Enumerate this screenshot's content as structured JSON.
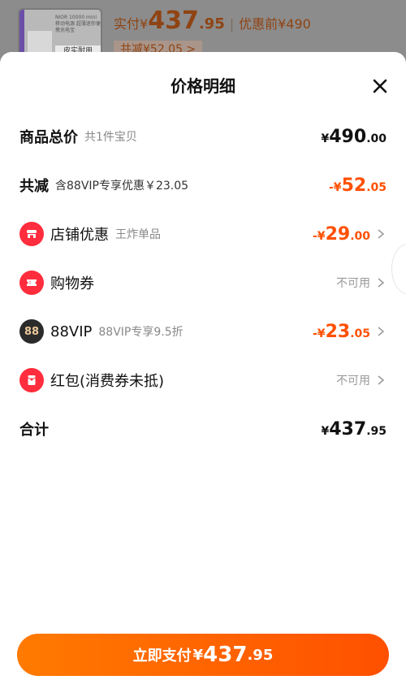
{
  "background": {
    "thumb_text": "NIOR 10000 mini 移动电源 超薄迷你便携充电宝",
    "thumb_tag": "皮实耐用",
    "price_prefix": "实付",
    "price_yen": "¥",
    "price_int": "437",
    "price_dec": ".95",
    "divider": "|",
    "before_label": "优惠前¥490",
    "discount_label": "共减¥52.05 >"
  },
  "sheet": {
    "title": "价格明细"
  },
  "rows": {
    "total": {
      "label": "商品总价",
      "sub": "共1件宝贝",
      "yen": "¥",
      "int": "490",
      "dec": ".00"
    },
    "reduce": {
      "label": "共减",
      "sub": "含88VIP专享优惠￥23.05",
      "prefix": "-¥",
      "int": "52",
      "dec": ".05"
    },
    "shop": {
      "label": "店铺优惠",
      "sub": "王炸单品",
      "prefix": "-¥",
      "int": "29",
      "dec": ".00"
    },
    "coupon": {
      "label": "购物券",
      "status": "不可用"
    },
    "vip": {
      "icon_text": "88",
      "label": "88VIP",
      "sub": "88VIP专享9.5折",
      "prefix": "-¥",
      "int": "23",
      "dec": ".05"
    },
    "redpacket": {
      "label": "红包(消费券未抵)",
      "status": "不可用"
    },
    "sum": {
      "label": "合计",
      "yen": "¥",
      "int": "437",
      "dec": ".95"
    }
  },
  "pay_button": {
    "label": "立即支付",
    "yen": "¥",
    "int": "437",
    "dec": ".95"
  },
  "colors": {
    "accent": "#ff5000",
    "icon_red": "#ff2d3d",
    "vip_dark": "#2b2b2b"
  }
}
